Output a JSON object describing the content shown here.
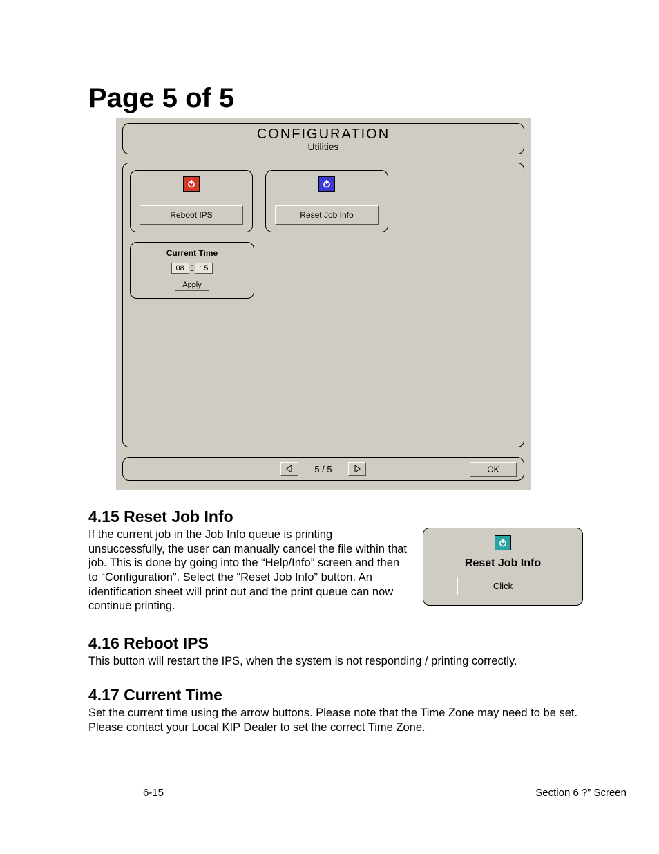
{
  "title": "Page 5 of 5",
  "config_screen": {
    "header_title": "CONFIGURATION",
    "header_sub": "Utilities",
    "tile_reboot_label": "Reboot IPS",
    "tile_reset_label": "Reset Job Info",
    "time_label": "Current Time",
    "time_hh": "08",
    "time_sep": ":",
    "time_mm": "15",
    "time_apply": "Apply",
    "page_indicator": "5 / 5",
    "ok_label": "OK"
  },
  "sections": {
    "s415": {
      "heading": "4.15 Reset Job Info",
      "body": "If the current job in the Job Info queue is printing unsuccessfully, the user can manually cancel the file within that job. This is done by going into the “Help/Info” screen and then to “Configuration”. Select the “Reset Job Info” button. An identification sheet will print out and the print queue can now continue printing.",
      "panel_label": "Reset Job Info",
      "panel_button": "Click"
    },
    "s416": {
      "heading": "4.16 Reboot IPS",
      "body": "This button will restart the IPS, when the system is not responding / printing correctly."
    },
    "s417": {
      "heading": "4.17 Current Time",
      "body": "Set the current time using the arrow buttons. Please note that the Time Zone may need to be set. Please contact your Local KIP Dealer to set the correct Time Zone."
    }
  },
  "footer": {
    "page_num": "6-15",
    "section_label": "Section 6    ?” Screen"
  }
}
